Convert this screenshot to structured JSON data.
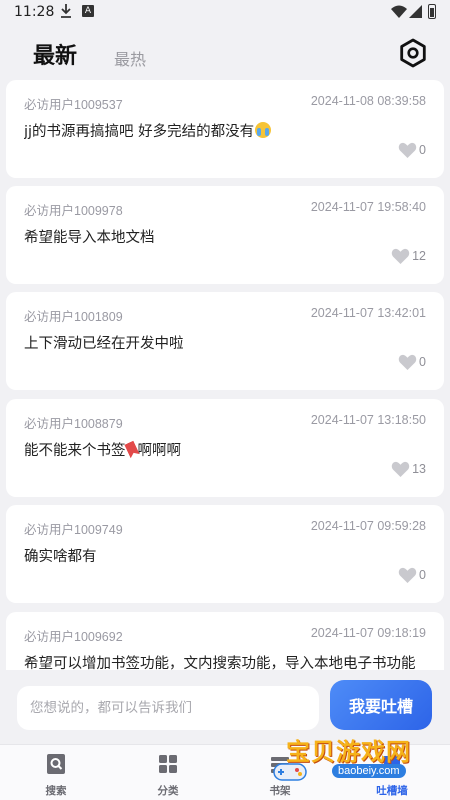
{
  "status_bar": {
    "time": "11:28",
    "a_badge": "A"
  },
  "header": {
    "tabs": [
      {
        "label": "最新",
        "active": true
      },
      {
        "label": "最热",
        "active": false
      }
    ],
    "settings_icon": "hexagon-settings-icon"
  },
  "posts": [
    {
      "user": "必访用户1009537",
      "time": "2024-11-08 08:39:58",
      "content": "jj的书源再搞搞吧 好多完结的都没有",
      "emoji": "crying-face",
      "likes": "0"
    },
    {
      "user": "必访用户1009978",
      "time": "2024-11-07 19:58:40",
      "content": "希望能导入本地文档",
      "likes": "12"
    },
    {
      "user": "必访用户1001809",
      "time": "2024-11-07 13:42:01",
      "content": "上下滑动已经在开发中啦",
      "likes": "0"
    },
    {
      "user": "必访用户1008879",
      "time": "2024-11-07 13:18:50",
      "content_before": "能不能来个书签",
      "emoji": "bookmark",
      "content_after": "啊啊啊",
      "likes": "13"
    },
    {
      "user": "必访用户1009749",
      "time": "2024-11-07 09:59:28",
      "content": "确实啥都有",
      "likes": "0"
    },
    {
      "user": "必访用户1009692",
      "time": "2024-11-07 09:18:19",
      "content": "希望可以增加书签功能，文内搜索功能，导入本地电子书功能"
    }
  ],
  "compose": {
    "placeholder": "您想说的，都可以告诉我们",
    "send_label": "我要吐槽"
  },
  "nav": [
    {
      "label": "搜索",
      "icon": "search-icon"
    },
    {
      "label": "分类",
      "icon": "category-icon"
    },
    {
      "label": "书架",
      "icon": "bookshelf-icon"
    },
    {
      "label": "吐槽墙",
      "icon": "feedback-wall-icon",
      "active": true
    }
  ],
  "watermark": {
    "text": "宝贝游戏网",
    "url": "baobeiy.com"
  },
  "colors": {
    "accent": "#2d64e8",
    "background": "#f1f1f4",
    "heart": "#c9c9ce"
  }
}
